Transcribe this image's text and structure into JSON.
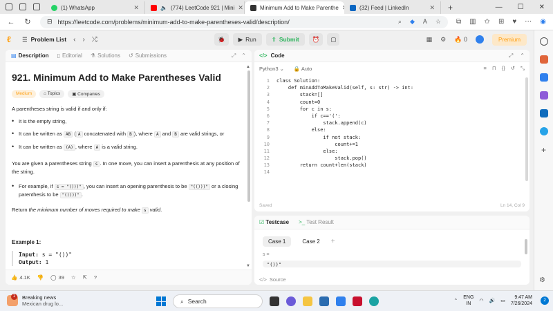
{
  "browser": {
    "tabs": [
      {
        "title": "(1) WhatsApp",
        "color": "#25d366"
      },
      {
        "title": "(774) LeetCode 921 | Mini",
        "color": "#ff0000"
      },
      {
        "title": "Minimum Add to Make Parenthe",
        "color": "#333333",
        "active": true
      },
      {
        "title": "(32) Feed | LinkedIn",
        "color": "#0a66c2"
      }
    ],
    "url": "https://leetcode.com/problems/minimum-add-to-make-parentheses-valid/description/"
  },
  "nav": {
    "problem_list": "Problem List",
    "run": "Run",
    "submit": "Submit",
    "streak": "0",
    "premium": "Premium"
  },
  "left": {
    "tabs": [
      "Description",
      "Editorial",
      "Solutions",
      "Submissions"
    ],
    "title": "921. Minimum Add to Make Parentheses Valid",
    "tags": [
      "Medium",
      "Topics",
      "Companies"
    ],
    "intro": "A parentheses string is valid if and only if:",
    "rules": [
      {
        "pre": "It is the empty string,",
        "parts": []
      },
      {
        "pre": "It can be written as ",
        "parts": [
          {
            "c": "AB"
          },
          {
            "t": " ("
          },
          {
            "c": "A"
          },
          {
            "t": " concatenated with "
          },
          {
            "c": "B"
          },
          {
            "t": "), where "
          },
          {
            "c": "A"
          },
          {
            "t": " and "
          },
          {
            "c": "B"
          },
          {
            "t": " are valid strings, or"
          }
        ]
      },
      {
        "pre": "It can be written as ",
        "parts": [
          {
            "c": "(A)"
          },
          {
            "t": ", where "
          },
          {
            "c": "A"
          },
          {
            "t": " is a valid string."
          }
        ]
      }
    ],
    "given_pre": "You are given a parentheses string ",
    "given_code": "s",
    "given_post": ". In one move, you can insert a parenthesis at any position of the string.",
    "example_bullet": {
      "t1": "For example, if ",
      "c1": "s = \"()))\"",
      "t2": ", you can insert an opening parenthesis to be ",
      "c2": "\"(()))\"",
      "t3": " or a closing parenthesis to be ",
      "c3": "\"())))\"",
      "t4": "."
    },
    "return_pre": "Return ",
    "return_em": "the minimum number of moves required to make ",
    "return_code": "s",
    "return_em2": " valid",
    "return_post": ".",
    "example_heading": "Example 1:",
    "example_input_label": "Input:",
    "example_input": "s = \"())\"",
    "example_output_label": "Output:",
    "example_output": "1",
    "footer": {
      "likes": "4.1K",
      "comments": "39"
    }
  },
  "code": {
    "header": "Code",
    "language": "Python3",
    "auto": "Auto",
    "lines": [
      "class Solution:",
      "    def minAddToMakeValid(self, s: str) -> int:",
      "        stack=[]",
      "        count=0",
      "        for c in s:",
      "            if c=='(':",
      "                stack.append(c)",
      "            else:",
      "                if not stack:",
      "                    count+=1",
      "                else:",
      "                    stack.pop()",
      "        return count+len(stack)",
      ""
    ],
    "saved": "Saved",
    "position": "Ln 14, Col 9"
  },
  "test": {
    "tab_testcase": "Testcase",
    "tab_result": "Test Result",
    "cases": [
      "Case 1",
      "Case 2"
    ],
    "label": "s =",
    "value": "\"())\"",
    "source": "Source"
  },
  "taskbar": {
    "news_title": "Breaking news",
    "news_sub": "Mexican drug lo...",
    "news_badge": "1",
    "search": "Search",
    "lang1": "ENG",
    "lang2": "IN",
    "time": "9:47 AM",
    "date": "7/26/2024",
    "notif": "2"
  }
}
